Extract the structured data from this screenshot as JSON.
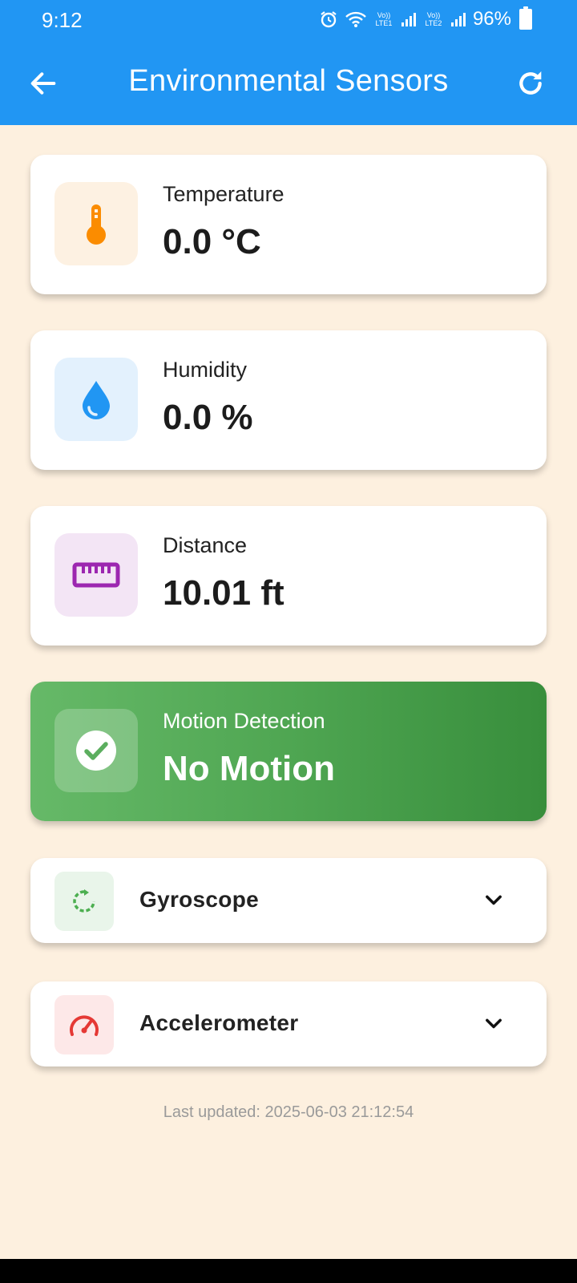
{
  "status_bar": {
    "time": "9:12",
    "battery": "96%",
    "sim1": "Vo)) LTE1",
    "sim2": "Vo)) LTE2"
  },
  "app_bar": {
    "title": "Environmental Sensors"
  },
  "sensors": {
    "temperature": {
      "label": "Temperature",
      "value": "0.0 °C",
      "icon": "thermometer-icon",
      "color": "#fb8c00"
    },
    "humidity": {
      "label": "Humidity",
      "value": "0.0 %",
      "icon": "water-drop-icon",
      "color": "#2196f3"
    },
    "distance": {
      "label": "Distance",
      "value": "10.01 ft",
      "icon": "ruler-icon",
      "color": "#9c27b0"
    },
    "motion": {
      "label": "Motion Detection",
      "value": "No Motion",
      "icon": "check-circle-icon",
      "color": "#43a047"
    }
  },
  "expanders": {
    "gyroscope": {
      "label": "Gyroscope",
      "icon": "rotate-icon",
      "color": "#4caf50"
    },
    "accelerometer": {
      "label": "Accelerometer",
      "icon": "speedometer-icon",
      "color": "#e53935"
    }
  },
  "footer": {
    "last_updated": "Last updated: 2025-06-03 21:12:54"
  }
}
